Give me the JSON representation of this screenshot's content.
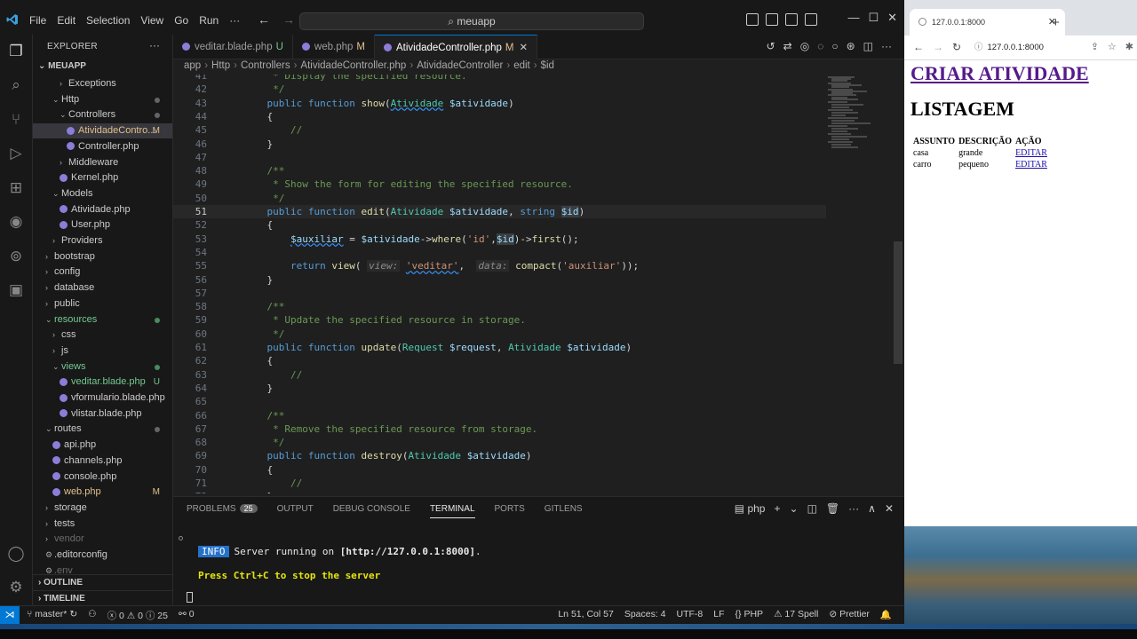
{
  "vscode": {
    "menu": [
      "File",
      "Edit",
      "Selection",
      "View",
      "Go",
      "Run",
      "···"
    ],
    "search": "meuapp",
    "explorer": {
      "title": "EXPLORER",
      "root": "MEUAPP",
      "items": [
        {
          "label": "Exceptions",
          "indent": 2,
          "type": "folder-closed"
        },
        {
          "label": "Http",
          "indent": 1,
          "type": "folder-open",
          "status": "dot"
        },
        {
          "label": "Controllers",
          "indent": 2,
          "type": "folder-open",
          "status": "dot"
        },
        {
          "label": "AtividadeContro...",
          "indent": 3,
          "type": "php",
          "status": "M",
          "selected": true
        },
        {
          "label": "Controller.php",
          "indent": 3,
          "type": "php"
        },
        {
          "label": "Middleware",
          "indent": 2,
          "type": "folder-closed"
        },
        {
          "label": "Kernel.php",
          "indent": 2,
          "type": "php"
        },
        {
          "label": "Models",
          "indent": 1,
          "type": "folder-open"
        },
        {
          "label": "Atividade.php",
          "indent": 2,
          "type": "php"
        },
        {
          "label": "User.php",
          "indent": 2,
          "type": "php"
        },
        {
          "label": "Providers",
          "indent": 1,
          "type": "folder-closed"
        },
        {
          "label": "bootstrap",
          "indent": 0,
          "type": "folder-closed"
        },
        {
          "label": "config",
          "indent": 0,
          "type": "folder-closed"
        },
        {
          "label": "database",
          "indent": 0,
          "type": "folder-closed"
        },
        {
          "label": "public",
          "indent": 0,
          "type": "folder-closed"
        },
        {
          "label": "resources",
          "indent": 0,
          "type": "folder-open",
          "status": "dot-green"
        },
        {
          "label": "css",
          "indent": 1,
          "type": "folder-closed"
        },
        {
          "label": "js",
          "indent": 1,
          "type": "folder-closed"
        },
        {
          "label": "views",
          "indent": 1,
          "type": "folder-open",
          "status": "dot-green"
        },
        {
          "label": "veditar.blade.php",
          "indent": 2,
          "type": "php",
          "status": "U"
        },
        {
          "label": "vformulario.blade.php",
          "indent": 2,
          "type": "php"
        },
        {
          "label": "vlistar.blade.php",
          "indent": 2,
          "type": "php"
        },
        {
          "label": "routes",
          "indent": 0,
          "type": "folder-open",
          "status": "dot"
        },
        {
          "label": "api.php",
          "indent": 1,
          "type": "php"
        },
        {
          "label": "channels.php",
          "indent": 1,
          "type": "php"
        },
        {
          "label": "console.php",
          "indent": 1,
          "type": "php"
        },
        {
          "label": "web.php",
          "indent": 1,
          "type": "php",
          "status": "M"
        },
        {
          "label": "storage",
          "indent": 0,
          "type": "folder-closed"
        },
        {
          "label": "tests",
          "indent": 0,
          "type": "folder-closed"
        },
        {
          "label": "vendor",
          "indent": 0,
          "type": "folder-closed",
          "dim": true
        },
        {
          "label": ".editorconfig",
          "indent": 0,
          "type": "config"
        },
        {
          "label": ".env",
          "indent": 0,
          "type": "config",
          "dim": true
        }
      ],
      "outline": "OUTLINE",
      "timeline": "TIMELINE"
    },
    "tabs": [
      {
        "label": "veditar.blade.php",
        "flag": "U"
      },
      {
        "label": "web.php",
        "flag": "M"
      },
      {
        "label": "AtividadeController.php",
        "flag": "M",
        "active": true
      }
    ],
    "breadcrumb": [
      "app",
      "Http",
      "Controllers",
      "AtividadeController.php",
      "AtividadeController",
      "edit",
      "$id"
    ],
    "code_lines": [
      {
        "n": 41,
        "html": "<span class='c-com'>     * Display the specified resource.</span>"
      },
      {
        "n": 42,
        "html": "<span class='c-com'>     */</span>"
      },
      {
        "n": 43,
        "html": "    <span class='c-kw'>public function</span> <span class='c-fn'>show</span>(<span class='c-cls squig'>Atividade</span> <span class='c-var'>$atividade</span>)"
      },
      {
        "n": 44,
        "html": "    {"
      },
      {
        "n": 45,
        "html": "        <span class='c-com'>//</span>"
      },
      {
        "n": 46,
        "html": "    }"
      },
      {
        "n": 47,
        "html": ""
      },
      {
        "n": 48,
        "html": "<span class='c-com'>    /**</span>"
      },
      {
        "n": 49,
        "html": "<span class='c-com'>     * Show the form for editing the specified resource.</span>"
      },
      {
        "n": 50,
        "html": "<span class='c-com'>     */</span>"
      },
      {
        "n": 51,
        "html": "    <span class='c-kw'>public function</span> <span class='c-fn'>edit</span>(<span class='c-cls'>Atividade</span> <span class='c-var'>$atividade</span>, <span class='c-kw'>string</span> <span class='c-var hl'>$id</span>)",
        "current": true
      },
      {
        "n": 52,
        "html": "    {"
      },
      {
        "n": 53,
        "html": "        <span class='c-var squig'>$auxiliar</span> = <span class='c-var'>$atividade</span>-><span class='c-fn'>where</span>(<span class='c-str'>'id'</span>,<span class='c-var hl'>$id</span>)-><span class='c-fn'>first</span>();"
      },
      {
        "n": 54,
        "html": ""
      },
      {
        "n": 55,
        "html": "        <span class='c-kw'>return</span> <span class='c-fn'>view</span>( <span class='c-hint'>view:</span> <span class='c-str squig'>'veditar'</span>,  <span class='c-hint'>data:</span> <span class='c-fn'>compact</span>(<span class='c-str'>'auxiliar'</span>));"
      },
      {
        "n": 56,
        "html": "    }"
      },
      {
        "n": 57,
        "html": ""
      },
      {
        "n": 58,
        "html": "<span class='c-com'>    /**</span>"
      },
      {
        "n": 59,
        "html": "<span class='c-com'>     * Update the specified resource in storage.</span>"
      },
      {
        "n": 60,
        "html": "<span class='c-com'>     */</span>"
      },
      {
        "n": 61,
        "html": "    <span class='c-kw'>public function</span> <span class='c-fn'>update</span>(<span class='c-cls'>Request</span> <span class='c-var'>$request</span>, <span class='c-cls'>Atividade</span> <span class='c-var'>$atividade</span>)"
      },
      {
        "n": 62,
        "html": "    {"
      },
      {
        "n": 63,
        "html": "        <span class='c-com'>//</span>"
      },
      {
        "n": 64,
        "html": "    }"
      },
      {
        "n": 65,
        "html": ""
      },
      {
        "n": 66,
        "html": "<span class='c-com'>    /**</span>"
      },
      {
        "n": 67,
        "html": "<span class='c-com'>     * Remove the specified resource from storage.</span>"
      },
      {
        "n": 68,
        "html": "<span class='c-com'>     */</span>"
      },
      {
        "n": 69,
        "html": "    <span class='c-kw'>public function</span> <span class='c-fn'>destroy</span>(<span class='c-cls'>Atividade</span> <span class='c-var'>$atividade</span>)"
      },
      {
        "n": 70,
        "html": "    {"
      },
      {
        "n": 71,
        "html": "        <span class='c-com'>//</span>"
      },
      {
        "n": 72,
        "html": "    }"
      }
    ],
    "panel": {
      "tabs": [
        "PROBLEMS",
        "OUTPUT",
        "DEBUG CONSOLE",
        "TERMINAL",
        "PORTS",
        "GITLENS"
      ],
      "active_tab": "TERMINAL",
      "problems_count": "25",
      "shell": "php",
      "info_tag": "INFO",
      "info_text": "Server running on ",
      "info_url": "[http://127.0.0.1:8000]",
      "info_end": ".",
      "stop_text": "Press Ctrl+C to stop the server"
    },
    "status": {
      "branch": "master*",
      "errors": "0",
      "warnings": "0",
      "info": "25",
      "ports": "0",
      "position": "Ln 51, Col 57",
      "spaces": "Spaces: 4",
      "encoding": "UTF-8",
      "eol": "LF",
      "language": "PHP",
      "spell": "17 Spell",
      "formatter": "Prettier"
    }
  },
  "browser": {
    "tab_title": "127.0.0.1:8000",
    "url": "127.0.0.1:8000",
    "page": {
      "create_link": "CRIAR ATIVIDADE",
      "heading": "LISTAGEM",
      "columns": [
        "ASSUNTO",
        "DESCRIÇÃO",
        "AÇÃO"
      ],
      "rows": [
        {
          "assunto": "casa",
          "descricao": "grande",
          "acao": "EDITAR"
        },
        {
          "assunto": "carro",
          "descricao": "pequeno",
          "acao": "EDITAR"
        }
      ]
    }
  },
  "colors": {
    "accent": "#0078d4",
    "modified": "#e2c08d",
    "untracked": "#73c991",
    "visited_link": "#551a8b"
  }
}
